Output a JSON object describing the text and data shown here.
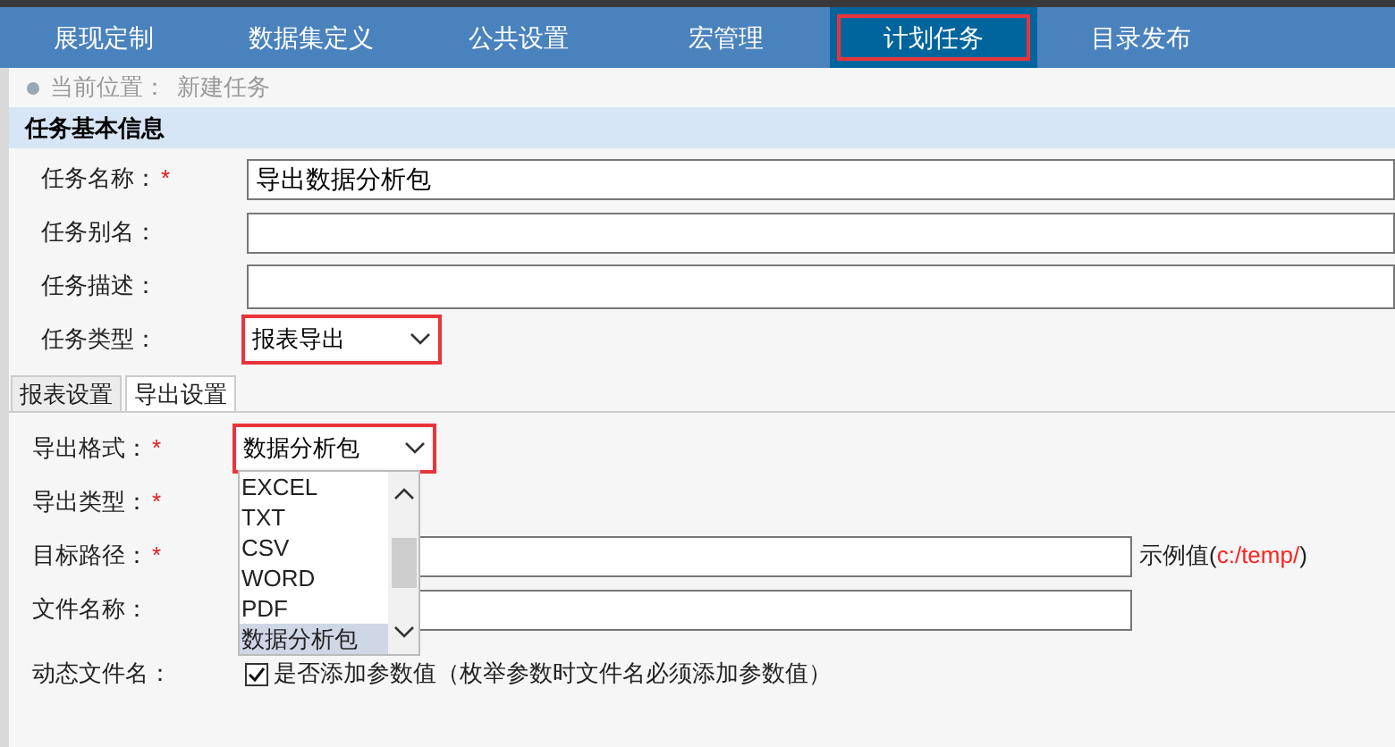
{
  "nav": [
    {
      "label": "展现定制",
      "selected": false,
      "highlighted": false
    },
    {
      "label": "数据集定义",
      "selected": false,
      "highlighted": false
    },
    {
      "label": "公共设置",
      "selected": false,
      "highlighted": false
    },
    {
      "label": "宏管理",
      "selected": false,
      "highlighted": false
    },
    {
      "label": "计划任务",
      "selected": true,
      "highlighted": true
    },
    {
      "label": "目录发布",
      "selected": false,
      "highlighted": false
    }
  ],
  "breadcrumb": {
    "label": "当前位置：",
    "value": "新建任务"
  },
  "section_title": "任务基本信息",
  "basic_fields": [
    {
      "kind": "text",
      "label": "任务名称：",
      "required_mark": "*",
      "value": "导出数据分析包"
    },
    {
      "kind": "text",
      "label": "任务别名："
    },
    {
      "kind": "textarea",
      "label": "任务描述："
    },
    {
      "kind": "select",
      "label": "任务类型：",
      "value": "报表导出",
      "highlighted": true
    }
  ],
  "tabs": [
    {
      "label": "报表设置",
      "selected": false
    },
    {
      "label": "导出设置",
      "selected": true
    }
  ],
  "export_fields": [
    {
      "kind": "select",
      "label": "导出格式：",
      "required_mark": "*",
      "value": "数据分析包",
      "highlighted": true,
      "options": [
        {
          "label": "EXCEL",
          "selected": false
        },
        {
          "label": "TXT",
          "selected": false
        },
        {
          "label": "CSV",
          "selected": false
        },
        {
          "label": "WORD",
          "selected": false
        },
        {
          "label": "PDF",
          "selected": false
        },
        {
          "label": "数据分析包",
          "selected": true
        }
      ]
    },
    {
      "kind": "hidden",
      "label": "导出类型：",
      "required_mark": "*"
    },
    {
      "kind": "text",
      "label": "目标路径：",
      "required_mark": "*",
      "hint": {
        "prefix": "示例值(",
        "path": "c:/temp/",
        "suffix": ")"
      }
    },
    {
      "kind": "text",
      "label": "文件名称："
    },
    {
      "kind": "checkbox",
      "label": "动态文件名：",
      "checked": true,
      "text": "是否添加参数值（枚举参数时文件名必须添加参数值）"
    }
  ]
}
